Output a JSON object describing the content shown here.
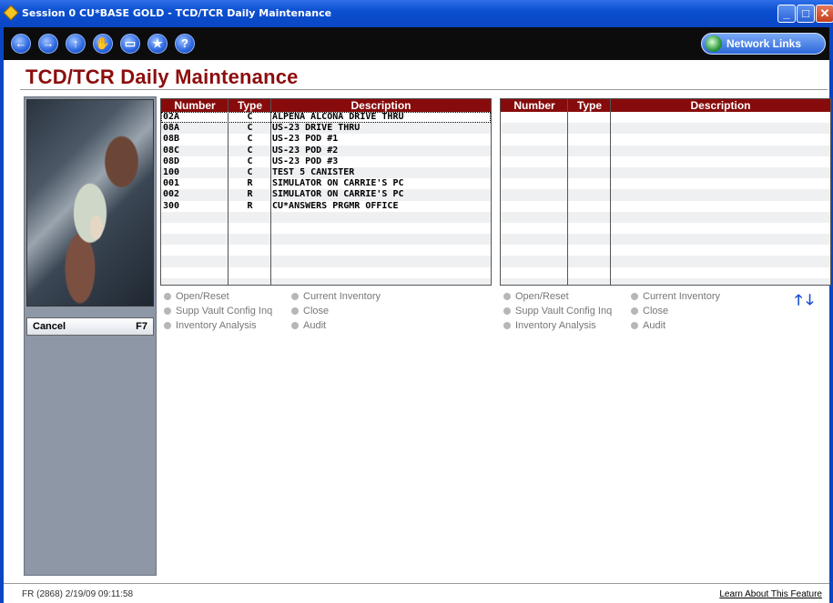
{
  "window": {
    "title": "Session 0 CU*BASE GOLD - TCD/TCR Daily Maintenance"
  },
  "toolbar": {
    "buttons": [
      {
        "icon": "back-arrow-icon",
        "glyph": "←"
      },
      {
        "icon": "forward-arrow-icon",
        "glyph": "→"
      },
      {
        "icon": "up-arrow-icon",
        "glyph": "↑"
      },
      {
        "icon": "hand-icon",
        "glyph": "✋"
      },
      {
        "icon": "printer-icon",
        "glyph": "▭"
      },
      {
        "icon": "star-icon",
        "glyph": "★"
      },
      {
        "icon": "help-icon",
        "glyph": "?"
      }
    ],
    "network_links": "Network Links"
  },
  "page": {
    "title": "TCD/TCR Daily Maintenance"
  },
  "sidebar": {
    "cancel_label": "Cancel",
    "cancel_key": "F7"
  },
  "left_grid": {
    "headers": {
      "number": "Number",
      "type": "Type",
      "description": "Description"
    },
    "rows": [
      {
        "number": "02A",
        "type": "C",
        "description": "ALPENA ALCONA DRIVE THRU"
      },
      {
        "number": "08A",
        "type": "C",
        "description": "US-23 DRIVE THRU"
      },
      {
        "number": "08B",
        "type": "C",
        "description": "US-23 POD #1"
      },
      {
        "number": "08C",
        "type": "C",
        "description": "US-23 POD #2"
      },
      {
        "number": "08D",
        "type": "C",
        "description": "US-23 POD #3"
      },
      {
        "number": "100",
        "type": "C",
        "description": "TEST 5 CANISTER"
      },
      {
        "number": "001",
        "type": "R",
        "description": "SIMULATOR ON CARRIE'S PC"
      },
      {
        "number": "002",
        "type": "R",
        "description": "SIMULATOR ON CARRIE'S PC"
      },
      {
        "number": "300",
        "type": "R",
        "description": "CU*ANSWERS PRGMR OFFICE"
      },
      {
        "number": "",
        "type": "",
        "description": ""
      },
      {
        "number": "",
        "type": "",
        "description": ""
      },
      {
        "number": "",
        "type": "",
        "description": ""
      },
      {
        "number": "",
        "type": "",
        "description": ""
      },
      {
        "number": "",
        "type": "",
        "description": ""
      },
      {
        "number": "",
        "type": "",
        "description": ""
      },
      {
        "number": "",
        "type": "",
        "description": ""
      }
    ]
  },
  "right_grid": {
    "headers": {
      "number": "Number",
      "type": "Type",
      "description": "Description"
    },
    "rows": 16
  },
  "left_actions": [
    "Open/Reset",
    "Current Inventory",
    "Supp Vault Config Inq",
    "Close",
    "Inventory Analysis",
    "Audit"
  ],
  "right_actions": [
    "Open/Reset",
    "Current Inventory",
    "Supp Vault Config Inq",
    "Close",
    "Inventory Analysis",
    "Audit"
  ],
  "status": {
    "left": "FR (2868) 2/19/09 09:11:58",
    "right": "Learn About This Feature"
  }
}
